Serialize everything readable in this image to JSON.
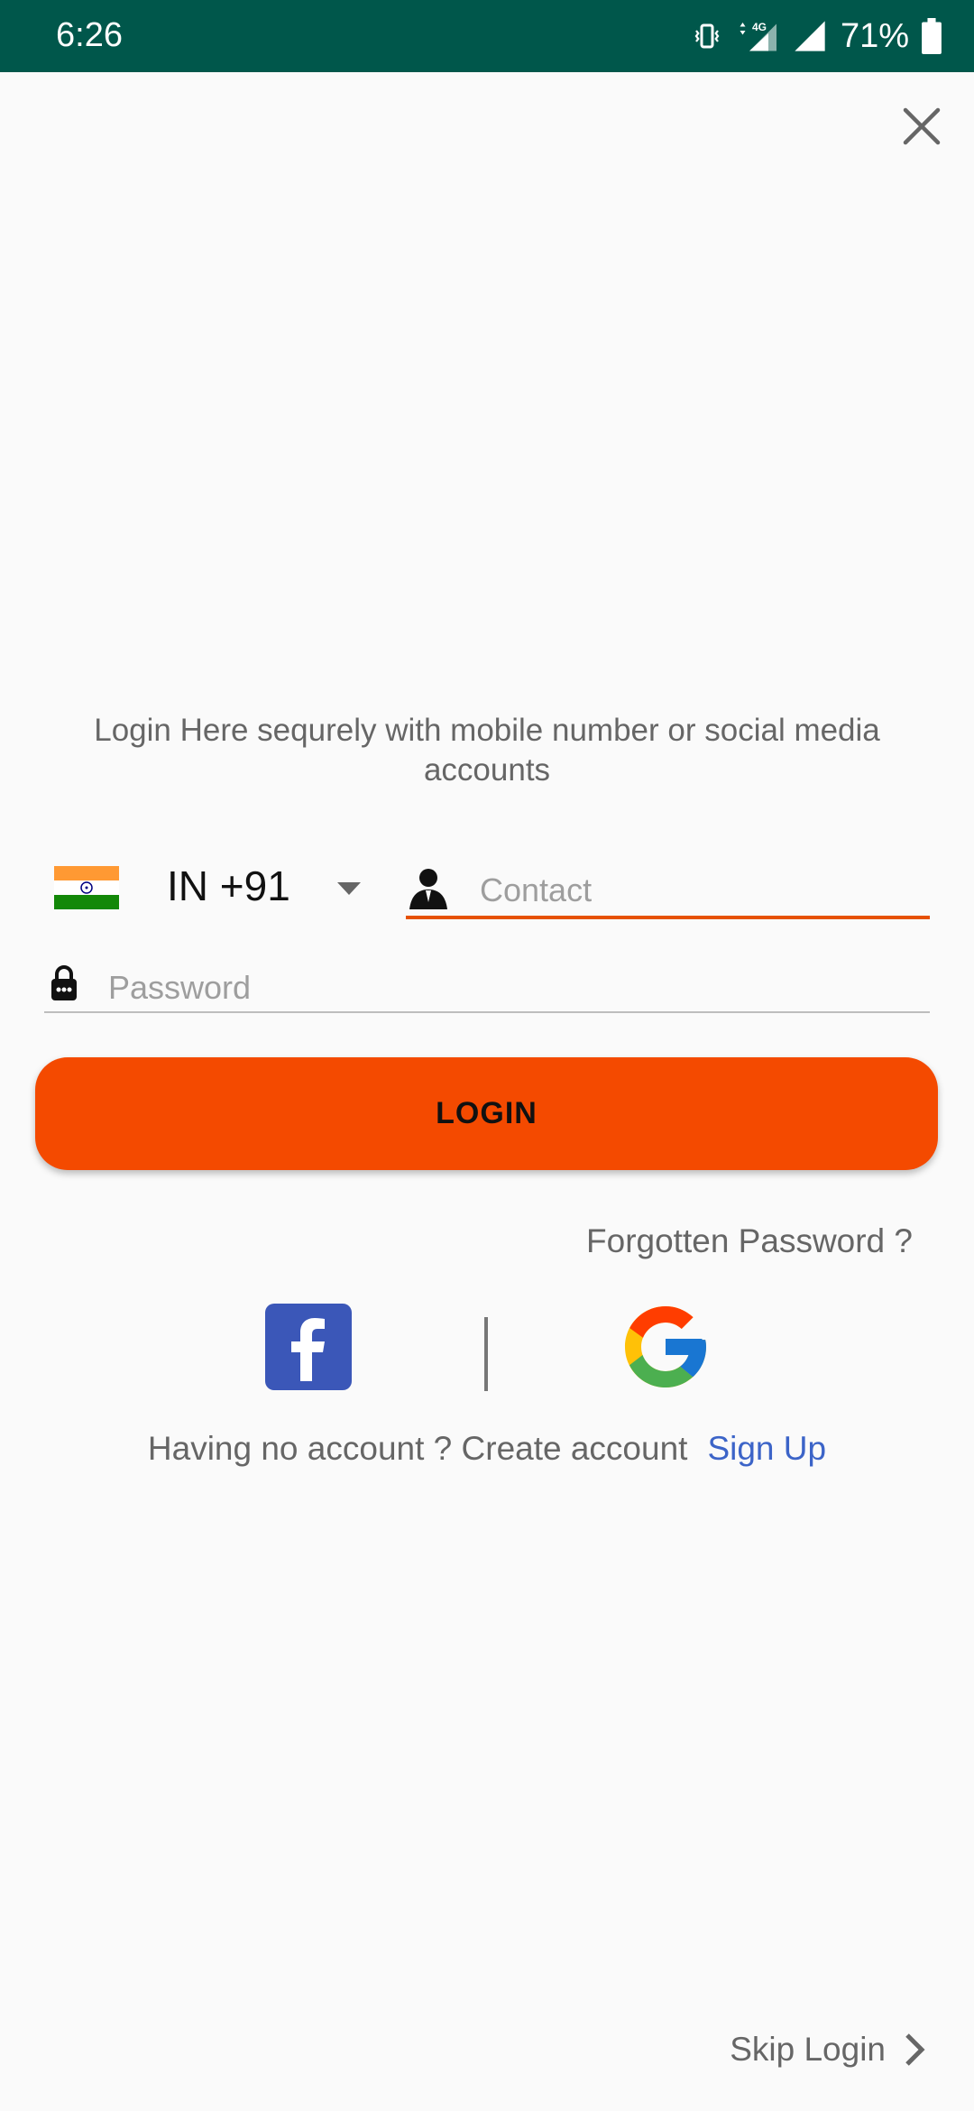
{
  "status_bar": {
    "time": "6:26",
    "battery": "71%",
    "network": "4G",
    "icons": [
      "vibrate-icon",
      "mobile-data-icon",
      "signal-icon",
      "battery-icon"
    ],
    "bg_color": "#00574b"
  },
  "intro_text": "Login Here sequrely with mobile number or social media accounts",
  "phone": {
    "country_code": "IN +91",
    "flag": "india-flag-icon",
    "contact_placeholder": "Contact"
  },
  "password": {
    "placeholder": "Password"
  },
  "login_button": "LOGIN",
  "forgot_password": "Forgotten Password ?",
  "social": [
    "facebook-icon",
    "google-icon"
  ],
  "signup": {
    "text": "Having no account ? Create account",
    "link": "Sign Up"
  },
  "skip_login": "Skip Login",
  "colors": {
    "accent": "#f44a00",
    "link": "#3c64c8",
    "status_bar": "#00574b"
  }
}
